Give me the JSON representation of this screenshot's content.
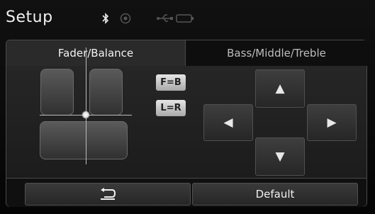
{
  "header": {
    "title": "Setup",
    "status_icons": [
      "bluetooth-icon",
      "gps-icon",
      "usb-icon",
      "battery-icon"
    ]
  },
  "tabs": [
    {
      "label": "Fader/Balance",
      "active": true
    },
    {
      "label": "Bass/Middle/Treble",
      "active": false
    }
  ],
  "buttons": {
    "fader_center": "F=B",
    "balance_center": "L=R",
    "default": "Default"
  },
  "icons": {
    "up": "up-arrow-icon",
    "down": "down-arrow-icon",
    "left": "left-arrow-icon",
    "right": "right-arrow-icon",
    "back": "back-icon"
  },
  "colors": {
    "background": "#000000",
    "panel": "#1a1a1a",
    "text": "#e8e8e8"
  }
}
